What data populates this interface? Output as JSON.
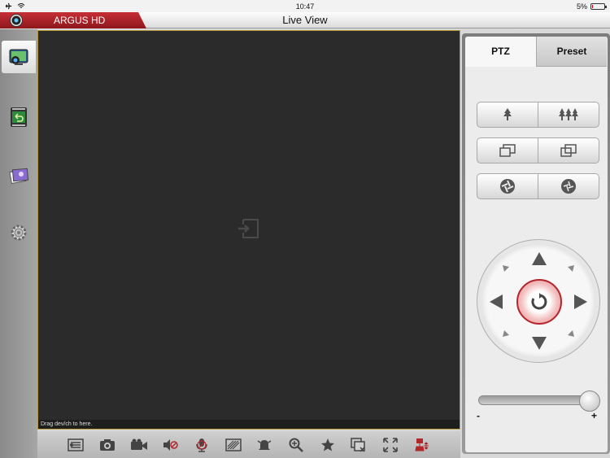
{
  "status_bar": {
    "time": "10:47",
    "battery": "5%",
    "battery_level": 0.05,
    "battery_color": "#cc0000"
  },
  "app": {
    "brand": "ARGUS HD",
    "title": "Live View",
    "accent_color": "#b3262b"
  },
  "sidebar": {
    "items": [
      {
        "icon": "live-view-icon",
        "active": true
      },
      {
        "icon": "playback-icon",
        "active": false
      },
      {
        "icon": "gallery-icon",
        "active": false
      },
      {
        "icon": "settings-icon",
        "active": false
      }
    ]
  },
  "video": {
    "hint": "Drag dev/ch to here.",
    "placeholder_icon": "drop-target-icon"
  },
  "toolbar": {
    "icons": [
      "layout-icon",
      "snapshot-icon",
      "record-icon",
      "audio-mute-icon",
      "talk-icon",
      "quality-icon",
      "alarm-icon",
      "digital-zoom-icon",
      "favorite-icon",
      "close-window-icon",
      "fullscreen-icon",
      "ptz-icon"
    ]
  },
  "ptz": {
    "tabs": [
      "PTZ",
      "Preset"
    ],
    "active_tab": "PTZ",
    "rows": [
      {
        "left": "zoom-in-icon",
        "right": "zoom-out-icon"
      },
      {
        "left": "focus-near-icon",
        "right": "focus-far-icon"
      },
      {
        "left": "iris-close-icon",
        "right": "iris-open-icon"
      }
    ],
    "slider": {
      "min_label": "-",
      "max_label": "+",
      "value": 1.0
    }
  }
}
